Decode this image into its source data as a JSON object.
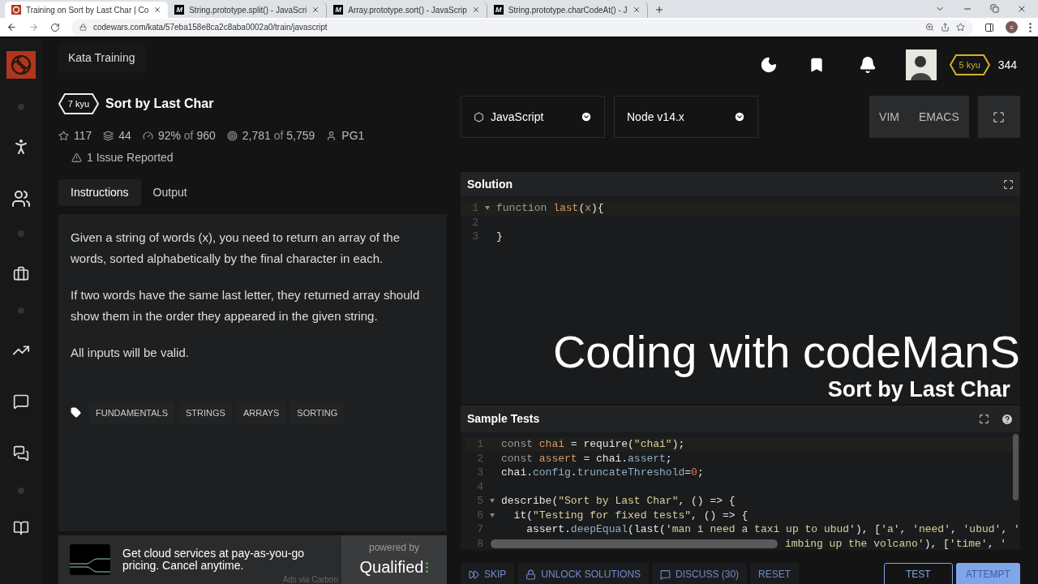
{
  "browser": {
    "tabs": [
      {
        "title": "Training on Sort by Last Char | Co",
        "kind": "codewars",
        "selected": true
      },
      {
        "title": "String.prototype.split() - JavaScri",
        "kind": "mdn",
        "favicon_text": "M",
        "selected": false
      },
      {
        "title": "Array.prototype.sort() - JavaScrip",
        "kind": "mdn",
        "favicon_text": "M",
        "selected": false
      },
      {
        "title": "String.prototype.charCodeAt() - J",
        "kind": "mdn",
        "favicon_text": "M",
        "selected": false
      }
    ],
    "url": "codewars.com/kata/57eba158e8ca2c8aba0002a0/train/javascript",
    "profile_initial": "c"
  },
  "header": {
    "section": "Kata Training",
    "rank": "5 kyu",
    "honor": "344"
  },
  "kata": {
    "rank": "7 kyu",
    "title": "Sort by Last Char",
    "stats": [
      {
        "kind": "stars",
        "text": "117"
      },
      {
        "kind": "collections",
        "text": "44"
      },
      {
        "kind": "satisfaction",
        "text": "92%",
        "muted": "of",
        "text2": "960"
      },
      {
        "kind": "completed",
        "text": "2,781",
        "muted": "of",
        "text2": "5,759"
      },
      {
        "kind": "author",
        "text": "PG1"
      }
    ],
    "issues": "1 Issue Reported",
    "tabs": [
      {
        "label": "Instructions",
        "selected": true
      },
      {
        "label": "Output",
        "selected": false
      }
    ],
    "paragraphs": [
      "Given a string of words (x), you need to return an array of the words, sorted alphabetically by the final character in each.",
      "If two words have the same last letter, they returned array should show them in the order they appeared in the given string.",
      "All inputs will be valid."
    ],
    "tags": [
      "FUNDAMENTALS",
      "STRINGS",
      "ARRAYS",
      "SORTING"
    ]
  },
  "ad": {
    "text": "Get cloud services at pay-as-you-go pricing. Cancel anytime.",
    "via": "Ads via Carbon",
    "powered_by": "powered by",
    "brand": "Qualified"
  },
  "editor": {
    "language": "JavaScript",
    "version": "Node v14.x",
    "modes": [
      "VIM",
      "EMACS"
    ],
    "solution": {
      "title": "Solution",
      "lines": [
        {
          "n": "1",
          "fold": true,
          "tokens": [
            {
              "kind": "kw",
              "t": "function "
            },
            {
              "kind": "var",
              "t": "last"
            },
            {
              "kind": "plain",
              "t": "("
            },
            {
              "kind": "var",
              "t": "x"
            },
            {
              "kind": "plain",
              "t": "){"
            }
          ]
        },
        {
          "n": "2",
          "fold": false
        },
        {
          "n": "3",
          "fold": false,
          "tokens": [
            {
              "kind": "plain",
              "t": "}"
            }
          ]
        }
      ]
    },
    "overlay": {
      "title": "Coding with codeManS",
      "subtitle": "Sort by Last Char"
    },
    "tests": {
      "title": "Sample Tests",
      "lines": [
        {
          "n": "1",
          "fold": false,
          "tokens": [
            {
              "kind": "kw",
              "t": "const "
            },
            {
              "kind": "var",
              "t": "chai"
            },
            {
              "kind": "plain",
              "t": " = require("
            },
            {
              "kind": "str",
              "t": "\"chai\""
            },
            {
              "kind": "plain",
              "t": ");"
            }
          ]
        },
        {
          "n": "2",
          "fold": false,
          "tokens": [
            {
              "kind": "kw",
              "t": "const "
            },
            {
              "kind": "var",
              "t": "assert"
            },
            {
              "kind": "plain",
              "t": " = chai."
            },
            {
              "kind": "prop",
              "t": "assert"
            },
            {
              "kind": "plain",
              "t": ";"
            }
          ]
        },
        {
          "n": "3",
          "fold": false,
          "tokens": [
            {
              "kind": "plain",
              "t": "chai."
            },
            {
              "kind": "prop",
              "t": "config"
            },
            {
              "kind": "plain",
              "t": "."
            },
            {
              "kind": "prop",
              "t": "truncateThreshold"
            },
            {
              "kind": "plain",
              "t": "="
            },
            {
              "kind": "num",
              "t": "0"
            },
            {
              "kind": "plain",
              "t": ";"
            }
          ]
        },
        {
          "n": "4",
          "fold": false
        },
        {
          "n": "5",
          "fold": true,
          "tokens": [
            {
              "kind": "plain",
              "t": "describe("
            },
            {
              "kind": "str",
              "t": "\"Sort by Last Char\""
            },
            {
              "kind": "plain",
              "t": ", () => {"
            }
          ]
        },
        {
          "n": "6",
          "fold": true,
          "tokens": [
            {
              "kind": "plain",
              "t": "  it("
            },
            {
              "kind": "str",
              "t": "\"Testing for fixed tests\""
            },
            {
              "kind": "plain",
              "t": ", () => {"
            }
          ]
        },
        {
          "n": "7",
          "fold": false,
          "tokens": [
            {
              "kind": "plain",
              "t": "    assert."
            },
            {
              "kind": "prop",
              "t": "deepEqual"
            },
            {
              "kind": "plain",
              "t": "(last("
            },
            {
              "kind": "str",
              "t": "'man i need a taxi up to ubud'"
            },
            {
              "kind": "plain",
              "t": "), ["
            },
            {
              "kind": "str",
              "t": "'a'"
            },
            {
              "kind": "plain",
              "t": ", "
            },
            {
              "kind": "str",
              "t": "'need'"
            },
            {
              "kind": "plain",
              "t": ", "
            },
            {
              "kind": "str",
              "t": "'ubud'"
            },
            {
              "kind": "plain",
              "t": ", "
            },
            {
              "kind": "str",
              "t": "'"
            }
          ]
        },
        {
          "n": "8",
          "fold": false,
          "hidden_start": true,
          "tokens": [
            {
              "kind": "str",
              "t": "imbing up the volcano'"
            },
            {
              "kind": "plain",
              "t": "), ["
            },
            {
              "kind": "str",
              "t": "'time'"
            },
            {
              "kind": "plain",
              "t": ", "
            },
            {
              "kind": "str",
              "t": "'"
            }
          ]
        }
      ]
    },
    "actions": [
      {
        "kind": "skip",
        "label": "SKIP"
      },
      {
        "kind": "unlock",
        "label": "UNLOCK SOLUTIONS"
      },
      {
        "kind": "discuss",
        "label": "DISCUSS (30)"
      },
      {
        "kind": "plain",
        "label": "RESET"
      },
      {
        "kind": "outline",
        "label": "TEST"
      },
      {
        "kind": "primary",
        "label": "ATTEMPT"
      }
    ]
  }
}
